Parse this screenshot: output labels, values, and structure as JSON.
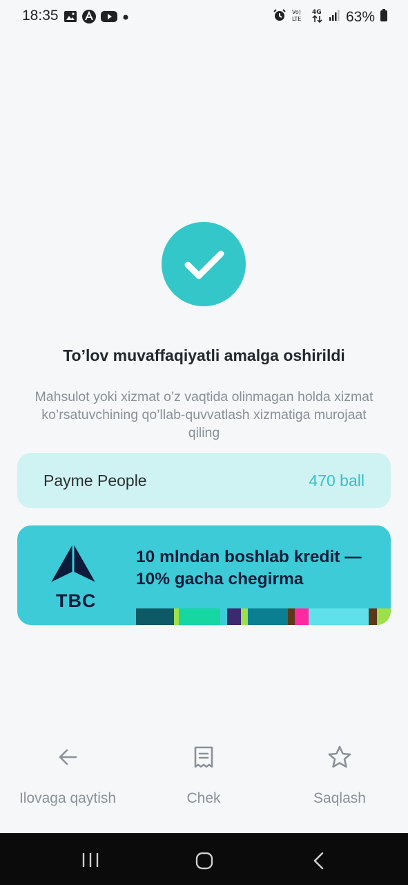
{
  "status_bar": {
    "time": "18:35",
    "battery": "63%",
    "network": "4G",
    "icons_left": [
      "image-icon",
      "vpn-icon",
      "youtube-icon",
      "dot-icon"
    ],
    "icons_right": [
      "alarm-icon",
      "volte-icon",
      "network-4g-icon",
      "signal-icon",
      "battery-icon"
    ]
  },
  "success": {
    "icon": "check-icon",
    "color": "#33c7c9",
    "title": "To’lov muvaffaqiyatli amalga oshirildi",
    "message": "Mahsulot yoki xizmat o’z vaqtida olinmagan holda xizmat ko’rsatuvchining qo’llab-quvvatlash xizmatiga murojaat qiling"
  },
  "people_card": {
    "label": "Payme People",
    "value": "470 ball"
  },
  "banner": {
    "logo_text": "TBC",
    "text": "10 mlndan boshlab kredit — 10% gacha chegirma"
  },
  "actions": [
    {
      "icon": "arrow-left-icon",
      "label": "Ilovaga qaytish"
    },
    {
      "icon": "receipt-icon",
      "label": "Chek"
    },
    {
      "icon": "star-icon",
      "label": "Saqlash"
    }
  ],
  "nav": [
    "recent-apps-icon",
    "home-icon",
    "back-icon"
  ]
}
